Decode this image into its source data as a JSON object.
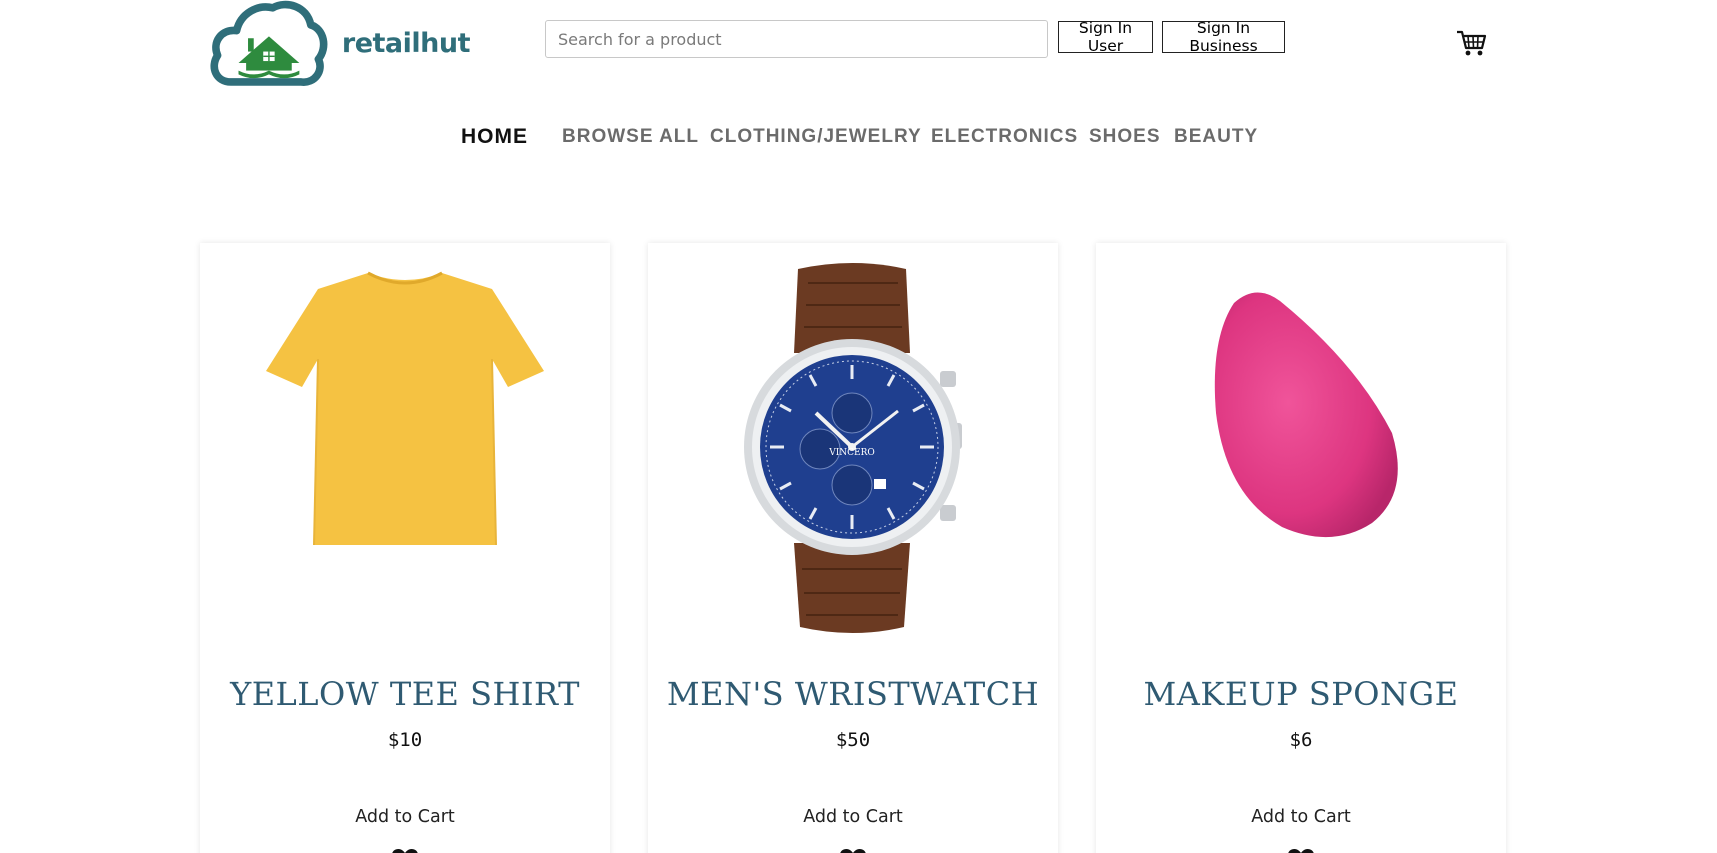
{
  "brand": {
    "name": "retailhut",
    "colors": {
      "cloud": "#2f6e7a",
      "house": "#2e8b3e",
      "text": "#2f6e7a"
    }
  },
  "search": {
    "placeholder": "Search for a product",
    "value": ""
  },
  "auth": {
    "sign_in_user": "Sign In User",
    "sign_in_business": "Sign In Business"
  },
  "cart": {
    "icon": "cart-icon"
  },
  "nav": {
    "items": [
      {
        "label": "HOME",
        "active": true
      },
      {
        "label": "BROWSE ALL",
        "active": false
      },
      {
        "label": "CLOTHING/JEWELRY",
        "active": false
      },
      {
        "label": "ELECTRONICS",
        "active": false
      },
      {
        "label": "SHOES",
        "active": false
      },
      {
        "label": "BEAUTY",
        "active": false
      }
    ]
  },
  "products": [
    {
      "title": "YELLOW TEE SHIRT",
      "price": "$10",
      "add_label": "Add to Cart",
      "image": "yellow-tee-shirt",
      "icon": "heart-icon"
    },
    {
      "title": "MEN'S WRISTWATCH",
      "price": "$50",
      "add_label": "Add to Cart",
      "image": "mens-wristwatch",
      "icon": "heart-icon",
      "watch_brand": "VINCERO"
    },
    {
      "title": "MAKEUP SPONGE",
      "price": "$6",
      "add_label": "Add to Cart",
      "image": "makeup-sponge",
      "icon": "heart-icon"
    }
  ],
  "colors": {
    "accent_title": "#2f5a72",
    "nav_inactive": "#6b6b6b",
    "nav_active": "#111111"
  }
}
